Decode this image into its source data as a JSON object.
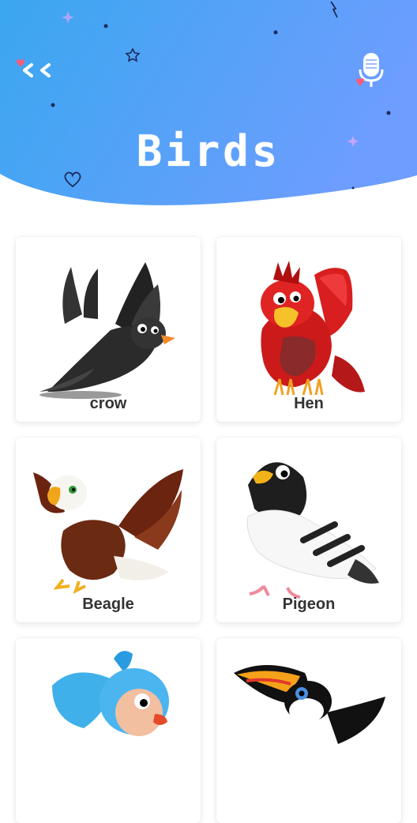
{
  "header": {
    "title": "Birds",
    "back_icon": "double-chevron-left-icon",
    "mic_icon": "microphone-icon",
    "gradient_start": "#3aa0ef",
    "gradient_end": "#6aa3ff"
  },
  "birds": [
    {
      "label": "crow"
    },
    {
      "label": "Hen"
    },
    {
      "label": "Beagle"
    },
    {
      "label": "Pigeon"
    },
    {
      "label": ""
    },
    {
      "label": ""
    }
  ]
}
